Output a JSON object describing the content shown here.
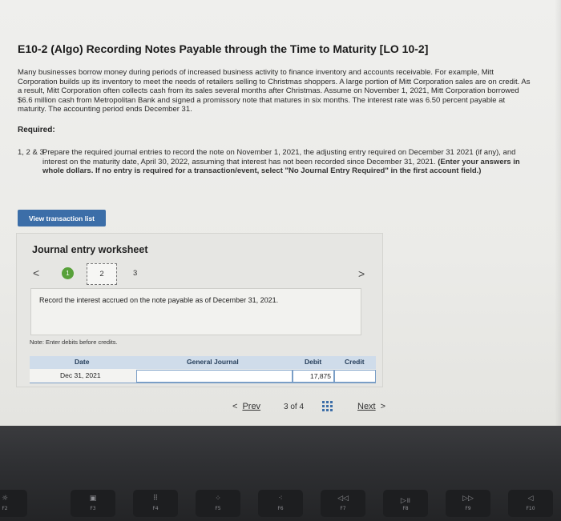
{
  "problem": {
    "title": "E10-2 (Algo) Recording Notes Payable through the Time to Maturity [LO 10-2]",
    "paragraph": "Many businesses borrow money during periods of increased business activity to finance inventory and accounts receivable. For example, Mitt Corporation builds up its inventory to meet the needs of retailers selling to Christmas shoppers. A large portion of Mitt Corporation sales are on credit. As a result, Mitt Corporation often collects cash from its sales several months after Christmas. Assume on November 1, 2021, Mitt Corporation borrowed $6.6 million cash from Metropolitan Bank and signed a promissory note that matures in six months. The interest rate was 6.50 percent payable at maturity. The accounting period ends December 31.",
    "required_label": "Required:",
    "instruction_number": "1, 2 & 3.",
    "instruction_text": "Prepare the required journal entries to record the note on November 1, 2021, the adjusting entry required on December 31 2021 (if any), and interest on the maturity date, April 30, 2022, assuming that interest has not been recorded since December 31, 2021.",
    "instruction_bold": "(Enter your answers in whole dollars. If no entry is required for a transaction/event, select \"No Journal Entry Required\" in the first account field.)"
  },
  "view_transaction_button": "View transaction list",
  "worksheet": {
    "title": "Journal entry worksheet",
    "steps": [
      "1",
      "2",
      "3"
    ],
    "description": "Record the interest accrued on the note payable as of December 31, 2021.",
    "note": "Note: Enter debits before credits.",
    "columns": [
      "Date",
      "General Journal",
      "Debit",
      "Credit"
    ],
    "rows": [
      {
        "date": "Dec 31, 2021",
        "account": "",
        "debit": "17,875",
        "credit": ""
      }
    ]
  },
  "pagination": {
    "prev_label": "Prev",
    "page_current": "3",
    "page_of": "of",
    "page_total": "4",
    "next_label": "Next"
  },
  "keyboard": {
    "keys": [
      {
        "icon": "☼",
        "label": "F2"
      },
      {
        "icon": "▣",
        "label": "F3"
      },
      {
        "icon": "⠿",
        "label": "F4"
      },
      {
        "icon": "⁘",
        "label": "F5"
      },
      {
        "icon": "⁖",
        "label": "F6"
      },
      {
        "icon": "◁◁",
        "label": "F7"
      },
      {
        "icon": "▷॥",
        "label": "F8"
      },
      {
        "icon": "▷▷",
        "label": "F9"
      },
      {
        "icon": "◁",
        "label": "F10"
      }
    ]
  }
}
